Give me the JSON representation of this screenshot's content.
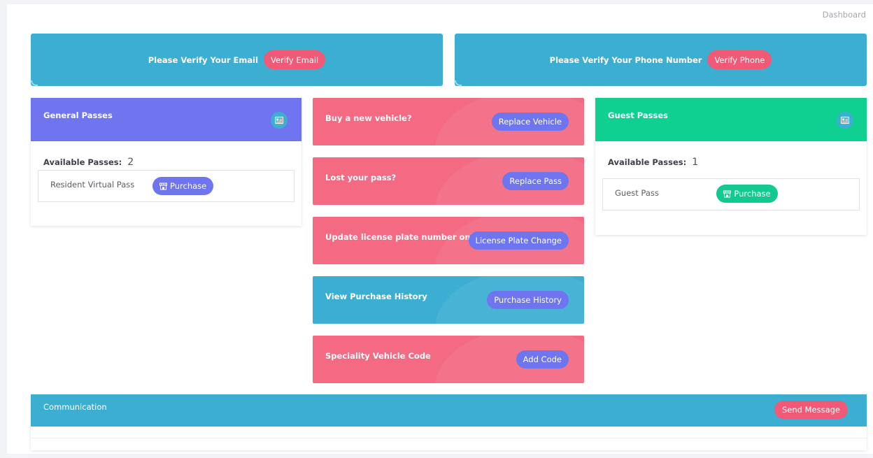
{
  "breadcrumb": "Dashboard",
  "banners": {
    "email": {
      "text": "Please Verify Your Email",
      "button": "Verify Email"
    },
    "phone": {
      "text": "Please Verify Your Phone Number",
      "button": "Verify Phone"
    }
  },
  "general_passes": {
    "title": "General Passes",
    "available_label": "Available Passes:",
    "available_count": "2",
    "items": [
      {
        "name": "Resident Virtual Pass",
        "button": "Purchase"
      }
    ]
  },
  "guest_passes": {
    "title": "Guest Passes",
    "available_label": "Available Passes:",
    "available_count": "1",
    "items": [
      {
        "name": "Guest Pass",
        "button": "Purchase"
      }
    ]
  },
  "actions": [
    {
      "title": "Buy a new vehicle?",
      "button": "Replace Vehicle"
    },
    {
      "title": "Lost your pass?",
      "button": "Replace Pass"
    },
    {
      "title": "Update license plate number only",
      "button": "License Plate Change"
    },
    {
      "title": "View Purchase History",
      "button": "Purchase History"
    },
    {
      "title": "Speciality Vehicle Code",
      "button": "Add Code"
    }
  ],
  "communication": {
    "title": "Communication",
    "button": "Send Message"
  },
  "icons": {
    "pass_card": "id-card-icon",
    "purchase": "storefront-icon"
  },
  "colors": {
    "teal": "#3caed2",
    "purple_header": "#6f74ef",
    "green_header": "#0fcf91",
    "red_action": "#f36a82",
    "red_pill": "#f05a77",
    "purple_pill": "#6f74ef",
    "green_pill": "#13c98f"
  }
}
